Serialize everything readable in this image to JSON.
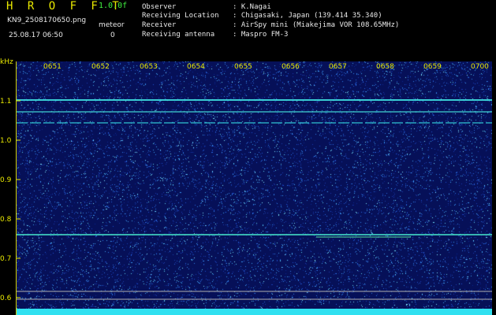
{
  "header": {
    "title": "H R O F F T",
    "version": "1.0.0f",
    "filename": "KN9_2508170650.png",
    "meteor_label": "meteor",
    "datetime": "25.08.17 06:50",
    "meteor_count": "0",
    "info": [
      {
        "key": "Observer",
        "value": ": K.Nagai"
      },
      {
        "key": "Receiving Location",
        "value": ": Chigasaki, Japan (139.414 35.340)"
      },
      {
        "key": "Receiver",
        "value": ": AirSpy mini (Miakejima VOR 108.65MHz)"
      },
      {
        "key": "Receiving antenna",
        "value": ": Maspro FM-3"
      }
    ]
  },
  "axis": {
    "unit": "kHz",
    "y_ticks": [
      "1.1",
      "1.0",
      "0.9",
      "0.8",
      "0.7",
      "0.6"
    ],
    "time_ticks": [
      "0651",
      "0652",
      "0653",
      "0654",
      "0655",
      "0656",
      "0657",
      "0658",
      "0659",
      "0700"
    ]
  },
  "colors": {
    "background": "#000000",
    "waterfall": "#071060",
    "axis": "#e8e800",
    "title": "#e8e800",
    "text": "#e8e8e8",
    "signal": "#40e0e0"
  }
}
